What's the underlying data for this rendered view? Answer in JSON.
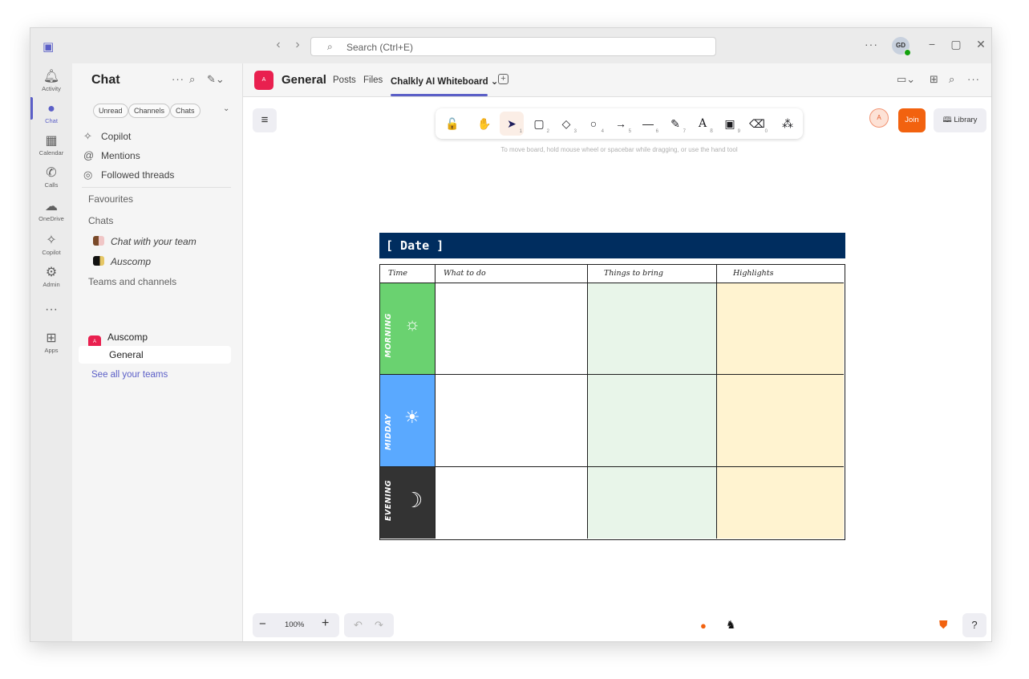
{
  "titlebar": {
    "search_placeholder": "Search (Ctrl+E)",
    "more": "···",
    "avatar_initials": "GD",
    "minimize": "−",
    "maximize": "▢",
    "close": "✕"
  },
  "rail": {
    "items": [
      {
        "label": "Activity",
        "icon": "bell-icon"
      },
      {
        "label": "Chat",
        "icon": "chat-icon"
      },
      {
        "label": "Calendar",
        "icon": "calendar-icon"
      },
      {
        "label": "Calls",
        "icon": "phone-icon"
      },
      {
        "label": "OneDrive",
        "icon": "cloud-icon"
      },
      {
        "label": "Copilot",
        "icon": "copilot-icon"
      },
      {
        "label": "Admin",
        "icon": "admin-icon"
      },
      {
        "label": "···",
        "icon": "more-icon"
      },
      {
        "label": "Apps",
        "icon": "plus-box-icon"
      }
    ]
  },
  "chatpanel": {
    "title": "Chat",
    "filters": [
      "Unread",
      "Channels",
      "Chats"
    ],
    "quick": [
      {
        "label": "Copilot",
        "icon": "copilot-icon"
      },
      {
        "label": "Mentions",
        "icon": "at-icon"
      },
      {
        "label": "Followed threads",
        "icon": "followed-icon"
      }
    ],
    "favourites": "Favourites",
    "chats_heading": "Chats",
    "chats": [
      "Chat with your team",
      "Auscomp"
    ],
    "teams_heading": "Teams and channels",
    "team_name": "Auscomp",
    "team_badge": "A",
    "channel_name": "General",
    "see_all": "See all your teams"
  },
  "channel": {
    "badge": "A",
    "name": "General",
    "tabs": [
      "Posts",
      "Files",
      "Chalkly AI Whiteboard ⌄"
    ]
  },
  "board": {
    "tools": [
      {
        "icon": "lock-icon",
        "glyph": "🔓",
        "key": ""
      },
      {
        "icon": "hand-icon",
        "glyph": "✋",
        "key": ""
      },
      {
        "icon": "select-arrow-icon",
        "glyph": "➤",
        "key": "1"
      },
      {
        "icon": "rectangle-icon",
        "glyph": "▢",
        "key": "2"
      },
      {
        "icon": "diamond-icon",
        "glyph": "◇",
        "key": "3"
      },
      {
        "icon": "ellipse-icon",
        "glyph": "○",
        "key": "4"
      },
      {
        "icon": "arrow-icon",
        "glyph": "→",
        "key": "5"
      },
      {
        "icon": "line-icon",
        "glyph": "—",
        "key": "6"
      },
      {
        "icon": "pencil-icon",
        "glyph": "✎",
        "key": "7"
      },
      {
        "icon": "text-icon",
        "glyph": "A",
        "key": "8"
      },
      {
        "icon": "image-icon",
        "glyph": "▣",
        "key": "9"
      },
      {
        "icon": "eraser-icon",
        "glyph": "⌫",
        "key": "0"
      },
      {
        "icon": "shapes-icon",
        "glyph": "⁂",
        "key": ""
      }
    ],
    "hint": "To move board, hold mouse wheel or spacebar while dragging, or use the hand tool",
    "collab_initial": "A",
    "join_label": "Join",
    "library_label": "Library",
    "zoom": "100%"
  },
  "planner": {
    "date": "[ Date ]",
    "columns": [
      "Time",
      "What to do",
      "Things to bring",
      "Highlights"
    ],
    "periods": [
      {
        "label": "MORNING",
        "color": "#6ad270",
        "icon": "sun-outline-icon",
        "glyph": "☼"
      },
      {
        "label": "MIDDAY",
        "color": "#5aa9ff",
        "icon": "sun-icon",
        "glyph": "☀"
      },
      {
        "label": "EVENING",
        "color": "#333333",
        "icon": "moon-icon",
        "glyph": "☽"
      }
    ],
    "colors": {
      "header": "#002d5f",
      "bring": "#e8f5e9",
      "highlights": "#fff3d0"
    }
  }
}
